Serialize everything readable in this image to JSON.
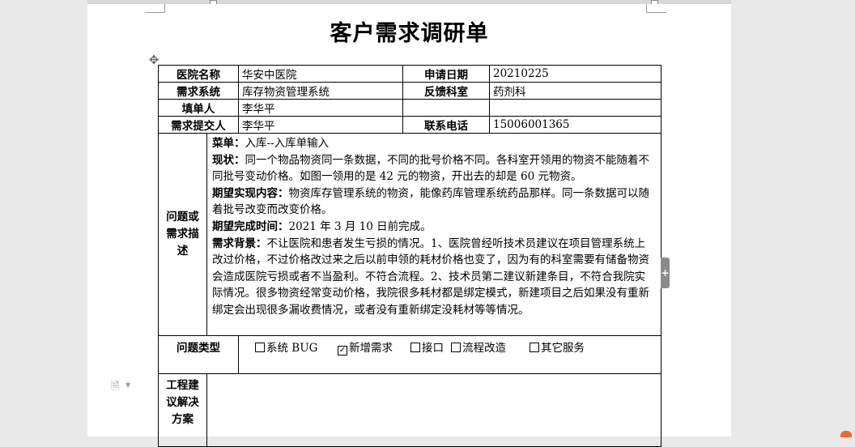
{
  "document": {
    "title": "客户需求调研单",
    "rows": [
      {
        "label1": "医院名称",
        "value1": "华安中医院",
        "label2": "申请日期",
        "value2": "20210225"
      },
      {
        "label1": "需求系统",
        "value1": "库存物资管理系统",
        "label2": "反馈科室",
        "value2": "药剂科"
      },
      {
        "label1": "填单人",
        "value1": "李华平",
        "label2": "",
        "value2": ""
      },
      {
        "label1": "需求提交人",
        "value1": "李华平",
        "label2": "联系电话",
        "value2": "15006001365"
      }
    ],
    "description": {
      "label_lines": [
        "问题或",
        "需求描",
        "述"
      ],
      "menu_label": "菜单：",
      "menu_text": "入库--入库单输入",
      "status_label": "现状：",
      "status_text": "同一个物品物资同一条数据，不同的批号价格不同。各科室开领用的物资不能随着不同批号变动价格。如图一领用的是 42 元的物资，开出去的却是 60 元物资。",
      "expected_label": "期望实现内容：",
      "expected_text": "物资库存管理系统的物资，能像药库管理系统药品那样。同一条数据可以随着批号改变而改变价格。",
      "deadline_label": "期望完成时间：",
      "deadline_text": "2021 年 3 月 10 日前完成。",
      "background_label": "需求背景：",
      "background_text": "不让医院和患者发生亏损的情况。1、医院曾经听技术员建议在项目管理系统上改过价格，不过价格改过来之后以前申领的耗材价格也变了，因为有的科室需要有储备物资会造成医院亏损或者不当盈利。不符合流程。2、技术员第二建议新建条目，不符合我院实际情况。很多物资经常变动价格，我院很多耗材都是绑定模式，新建项目之后如果没有重新绑定会出现很多漏收费情况，或者没有重新绑定没耗材等等情况。"
    },
    "problem_type": {
      "label": "问题类型",
      "options": [
        {
          "label": "系统 BUG",
          "checked": false
        },
        {
          "label": "新增需求",
          "checked": true
        },
        {
          "label": "接口",
          "checked": false
        },
        {
          "label": "流程改造",
          "checked": false
        },
        {
          "label": "其它服务",
          "checked": false
        }
      ]
    },
    "solution": {
      "label_lines": [
        "工程建",
        "议解决",
        "方案"
      ],
      "text": ""
    }
  },
  "ui": {
    "side_tab_glyph": "+",
    "move_icon": "move-handle-icon",
    "doc_icon": "document-icon",
    "accent": "#f06a27"
  }
}
